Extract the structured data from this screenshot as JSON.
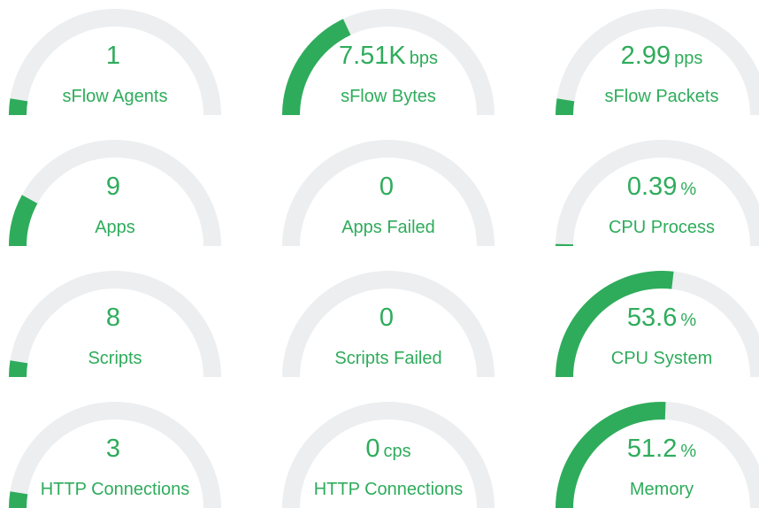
{
  "colors": {
    "accent": "#2eac5b",
    "track": "#eceef0"
  },
  "gauges": [
    {
      "value": "1",
      "unit": "",
      "label": "sFlow Agents",
      "fraction": 0.05
    },
    {
      "value": "7.51K",
      "unit": "bps",
      "label": "sFlow Bytes",
      "fraction": 0.36
    },
    {
      "value": "2.99",
      "unit": "pps",
      "label": "sFlow Packets",
      "fraction": 0.05
    },
    {
      "value": "9",
      "unit": "",
      "label": "Apps",
      "fraction": 0.16
    },
    {
      "value": "0",
      "unit": "",
      "label": "Apps Failed",
      "fraction": 0
    },
    {
      "value": "0.39",
      "unit": "%",
      "label": "CPU Process",
      "fraction": 0.0039
    },
    {
      "value": "8",
      "unit": "",
      "label": "Scripts",
      "fraction": 0.05
    },
    {
      "value": "0",
      "unit": "",
      "label": "Scripts Failed",
      "fraction": 0
    },
    {
      "value": "53.6",
      "unit": "%",
      "label": "CPU System",
      "fraction": 0.536
    },
    {
      "value": "3",
      "unit": "",
      "label": "HTTP Connections",
      "fraction": 0.05
    },
    {
      "value": "0",
      "unit": "cps",
      "label": "HTTP Connections",
      "fraction": 0
    },
    {
      "value": "51.2",
      "unit": "%",
      "label": "Memory",
      "fraction": 0.512
    }
  ]
}
